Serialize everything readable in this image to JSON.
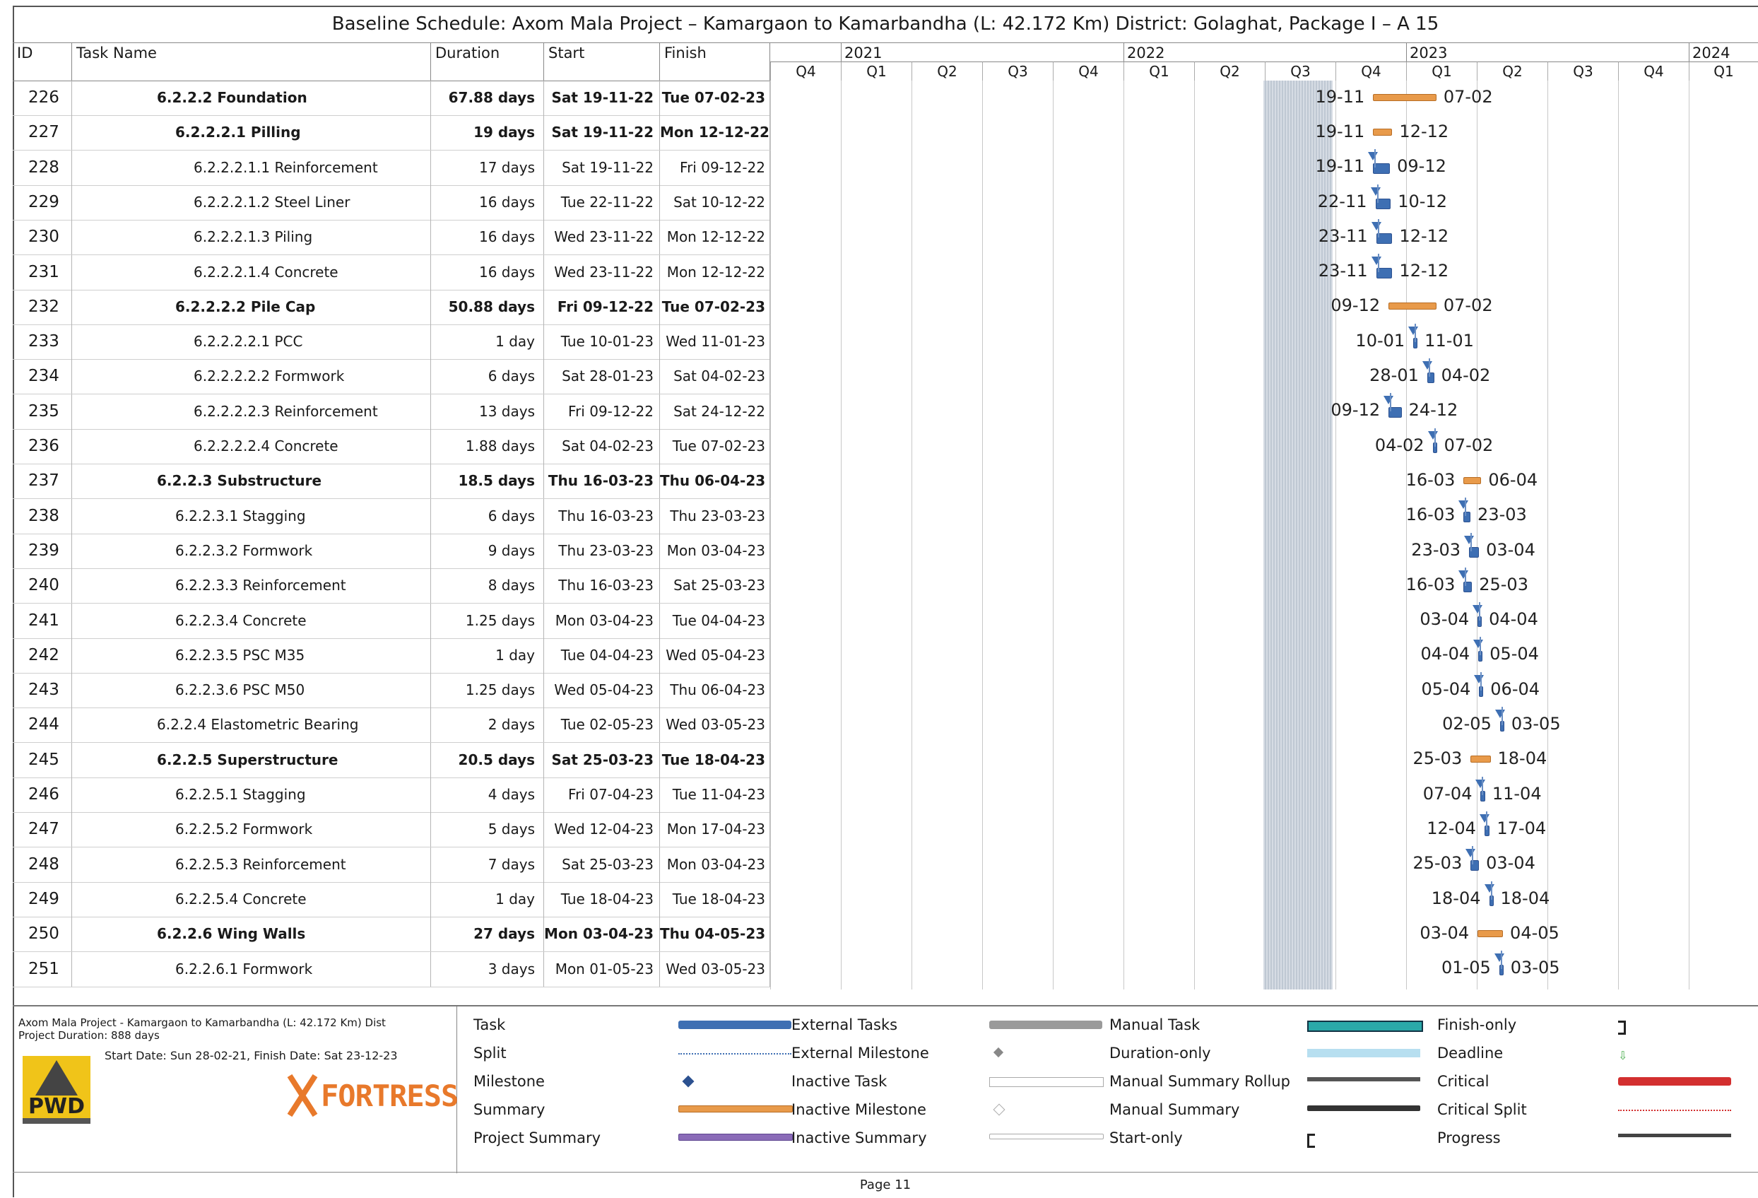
{
  "title": "Baseline Schedule: Axom Mala Project – Kamargaon to Kamarbandha (L: 42.172 Km) District: Golaghat, Package I – A 15",
  "columns": {
    "id": "ID",
    "name": "Task Name",
    "duration": "Duration",
    "start": "Start",
    "finish": "Finish"
  },
  "timeline": {
    "years": [
      "2021",
      "2022",
      "2023",
      "2024"
    ],
    "quarters": [
      "Q4",
      "Q1",
      "Q2",
      "Q3",
      "Q4",
      "Q1",
      "Q2",
      "Q3",
      "Q4",
      "Q1",
      "Q2",
      "Q3",
      "Q4",
      "Q1"
    ]
  },
  "tasks": [
    {
      "id": "226",
      "name": "6.2.2.2 Foundation",
      "duration": "67.88 days",
      "start": "Sat 19-11-22",
      "finish": "Tue 07-02-23",
      "level": 0,
      "summary": true,
      "start_label": "19-11",
      "finish_label": "07-02"
    },
    {
      "id": "227",
      "name": "6.2.2.2.1 Pilling",
      "duration": "19 days",
      "start": "Sat 19-11-22",
      "finish": "Mon 12-12-22",
      "level": 1,
      "summary": true,
      "start_label": "19-11",
      "finish_label": "12-12"
    },
    {
      "id": "228",
      "name": "6.2.2.2.1.1 Reinforcement",
      "duration": "17 days",
      "start": "Sat 19-11-22",
      "finish": "Fri 09-12-22",
      "level": 2,
      "summary": false,
      "start_label": "19-11",
      "finish_label": "09-12"
    },
    {
      "id": "229",
      "name": "6.2.2.2.1.2 Steel Liner",
      "duration": "16 days",
      "start": "Tue 22-11-22",
      "finish": "Sat 10-12-22",
      "level": 2,
      "summary": false,
      "start_label": "22-11",
      "finish_label": "10-12"
    },
    {
      "id": "230",
      "name": "6.2.2.2.1.3 Piling",
      "duration": "16 days",
      "start": "Wed 23-11-22",
      "finish": "Mon 12-12-22",
      "level": 2,
      "summary": false,
      "start_label": "23-11",
      "finish_label": "12-12"
    },
    {
      "id": "231",
      "name": "6.2.2.2.1.4 Concrete",
      "duration": "16 days",
      "start": "Wed 23-11-22",
      "finish": "Mon 12-12-22",
      "level": 2,
      "summary": false,
      "start_label": "23-11",
      "finish_label": "12-12"
    },
    {
      "id": "232",
      "name": "6.2.2.2.2 Pile Cap",
      "duration": "50.88 days",
      "start": "Fri 09-12-22",
      "finish": "Tue 07-02-23",
      "level": 1,
      "summary": true,
      "start_label": "09-12",
      "finish_label": "07-02"
    },
    {
      "id": "233",
      "name": "6.2.2.2.2.1 PCC",
      "duration": "1 day",
      "start": "Tue 10-01-23",
      "finish": "Wed 11-01-23",
      "level": 2,
      "summary": false,
      "start_label": "10-01",
      "finish_label": "11-01"
    },
    {
      "id": "234",
      "name": "6.2.2.2.2.2 Formwork",
      "duration": "6 days",
      "start": "Sat 28-01-23",
      "finish": "Sat 04-02-23",
      "level": 2,
      "summary": false,
      "start_label": "28-01",
      "finish_label": "04-02"
    },
    {
      "id": "235",
      "name": "6.2.2.2.2.3 Reinforcement",
      "duration": "13 days",
      "start": "Fri 09-12-22",
      "finish": "Sat 24-12-22",
      "level": 2,
      "summary": false,
      "start_label": "09-12",
      "finish_label": "24-12"
    },
    {
      "id": "236",
      "name": "6.2.2.2.2.4 Concrete",
      "duration": "1.88 days",
      "start": "Sat 04-02-23",
      "finish": "Tue 07-02-23",
      "level": 2,
      "summary": false,
      "start_label": "04-02",
      "finish_label": "07-02"
    },
    {
      "id": "237",
      "name": "6.2.2.3 Substructure",
      "duration": "18.5 days",
      "start": "Thu 16-03-23",
      "finish": "Thu 06-04-23",
      "level": 0,
      "summary": true,
      "start_label": "16-03",
      "finish_label": "06-04"
    },
    {
      "id": "238",
      "name": "6.2.2.3.1 Stagging",
      "duration": "6 days",
      "start": "Thu 16-03-23",
      "finish": "Thu 23-03-23",
      "level": 1,
      "summary": false,
      "start_label": "16-03",
      "finish_label": "23-03"
    },
    {
      "id": "239",
      "name": "6.2.2.3.2 Formwork",
      "duration": "9 days",
      "start": "Thu 23-03-23",
      "finish": "Mon 03-04-23",
      "level": 1,
      "summary": false,
      "start_label": "23-03",
      "finish_label": "03-04"
    },
    {
      "id": "240",
      "name": "6.2.2.3.3 Reinforcement",
      "duration": "8 days",
      "start": "Thu 16-03-23",
      "finish": "Sat 25-03-23",
      "level": 1,
      "summary": false,
      "start_label": "16-03",
      "finish_label": "25-03"
    },
    {
      "id": "241",
      "name": "6.2.2.3.4 Concrete",
      "duration": "1.25 days",
      "start": "Mon 03-04-23",
      "finish": "Tue 04-04-23",
      "level": 1,
      "summary": false,
      "start_label": "03-04",
      "finish_label": "04-04"
    },
    {
      "id": "242",
      "name": "6.2.2.3.5 PSC M35",
      "duration": "1 day",
      "start": "Tue 04-04-23",
      "finish": "Wed 05-04-23",
      "level": 1,
      "summary": false,
      "start_label": "04-04",
      "finish_label": "05-04"
    },
    {
      "id": "243",
      "name": "6.2.2.3.6 PSC M50",
      "duration": "1.25 days",
      "start": "Wed 05-04-23",
      "finish": "Thu 06-04-23",
      "level": 1,
      "summary": false,
      "start_label": "05-04",
      "finish_label": "06-04"
    },
    {
      "id": "244",
      "name": "6.2.2.4  Elastometric Bearing",
      "duration": "2 days",
      "start": "Tue 02-05-23",
      "finish": "Wed 03-05-23",
      "level": 0,
      "summary": false,
      "start_label": "02-05",
      "finish_label": "03-05"
    },
    {
      "id": "245",
      "name": "6.2.2.5 Superstructure",
      "duration": "20.5 days",
      "start": "Sat 25-03-23",
      "finish": "Tue 18-04-23",
      "level": 0,
      "summary": true,
      "start_label": "25-03",
      "finish_label": "18-04"
    },
    {
      "id": "246",
      "name": "6.2.2.5.1 Stagging",
      "duration": "4 days",
      "start": "Fri 07-04-23",
      "finish": "Tue 11-04-23",
      "level": 1,
      "summary": false,
      "start_label": "07-04",
      "finish_label": "11-04"
    },
    {
      "id": "247",
      "name": "6.2.2.5.2 Formwork",
      "duration": "5 days",
      "start": "Wed 12-04-23",
      "finish": "Mon 17-04-23",
      "level": 1,
      "summary": false,
      "start_label": "12-04",
      "finish_label": "17-04"
    },
    {
      "id": "248",
      "name": "6.2.2.5.3 Reinforcement",
      "duration": "7 days",
      "start": "Sat 25-03-23",
      "finish": "Mon 03-04-23",
      "level": 1,
      "summary": false,
      "start_label": "25-03",
      "finish_label": "03-04"
    },
    {
      "id": "249",
      "name": "6.2.2.5.4 Concrete",
      "duration": "1 day",
      "start": "Tue 18-04-23",
      "finish": "Tue 18-04-23",
      "level": 1,
      "summary": false,
      "start_label": "18-04",
      "finish_label": "18-04"
    },
    {
      "id": "250",
      "name": "6.2.2.6  Wing Walls",
      "duration": "27 days",
      "start": "Mon 03-04-23",
      "finish": "Thu 04-05-23",
      "level": 0,
      "summary": true,
      "start_label": "03-04",
      "finish_label": "04-05"
    },
    {
      "id": "251",
      "name": "6.2.2.6.1 Formwork",
      "duration": "3 days",
      "start": "Mon 01-05-23",
      "finish": "Wed 03-05-23",
      "level": 1,
      "summary": false,
      "start_label": "01-05",
      "finish_label": "03-05"
    }
  ],
  "legend": {
    "project_info": "Axom Mala Project - Kamargaon to Kamarbandha (L: 42.172 Km) Dist",
    "project_duration": "Project Duration: 888 days",
    "dates": "Start Date: Sun 28-02-21,  Finish Date: Sat 23-12-23",
    "pwd_logo": "PWD",
    "company_logo": "FORTRESS",
    "items": [
      [
        "Task",
        "External Tasks",
        "Manual Task",
        "Finish-only"
      ],
      [
        "Split",
        "External Milestone",
        "Duration-only",
        "Deadline"
      ],
      [
        "Milestone",
        "Inactive Task",
        "Manual Summary Rollup",
        "Critical"
      ],
      [
        "Summary",
        "Inactive Milestone",
        "Manual Summary",
        "Critical Split"
      ],
      [
        "Project Summary",
        "Inactive Summary",
        "Start-only",
        "Progress"
      ]
    ]
  },
  "footer": "Page 11",
  "colors": {
    "summary": "#e89a4a",
    "task": "#3e6fb3",
    "critical": "#d32f2f",
    "manual_task": "#2aa9a9",
    "project_summary": "#8a6bb8"
  }
}
